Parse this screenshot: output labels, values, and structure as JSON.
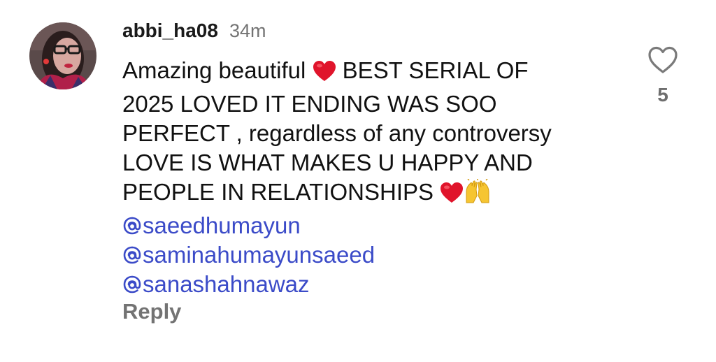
{
  "comment": {
    "username": "abbi_ha08",
    "timestamp": "34m",
    "text_lines": [
      "Amazing beautiful",
      "BEST SERIAL OF",
      "2025 LOVED IT ENDING WAS SOO",
      "PERFECT , regardless of any controversy",
      "LOVE IS WHAT MAKES U HAPPY AND",
      "PEOPLE IN RELATIONSHIPS"
    ],
    "emojis": [
      "red-heart",
      "raising-hands"
    ],
    "mentions": [
      "saeedhumayun",
      "saminahumayunsaeed",
      "sanashahnawaz"
    ],
    "reply_label": "Reply",
    "like_count": "5"
  },
  "colors": {
    "mention": "#3b4bc8",
    "muted": "#737373",
    "heart": "#e0142b"
  },
  "icons": {
    "like": "heart-outline-icon",
    "mention_prefix": "threads-at-icon"
  }
}
